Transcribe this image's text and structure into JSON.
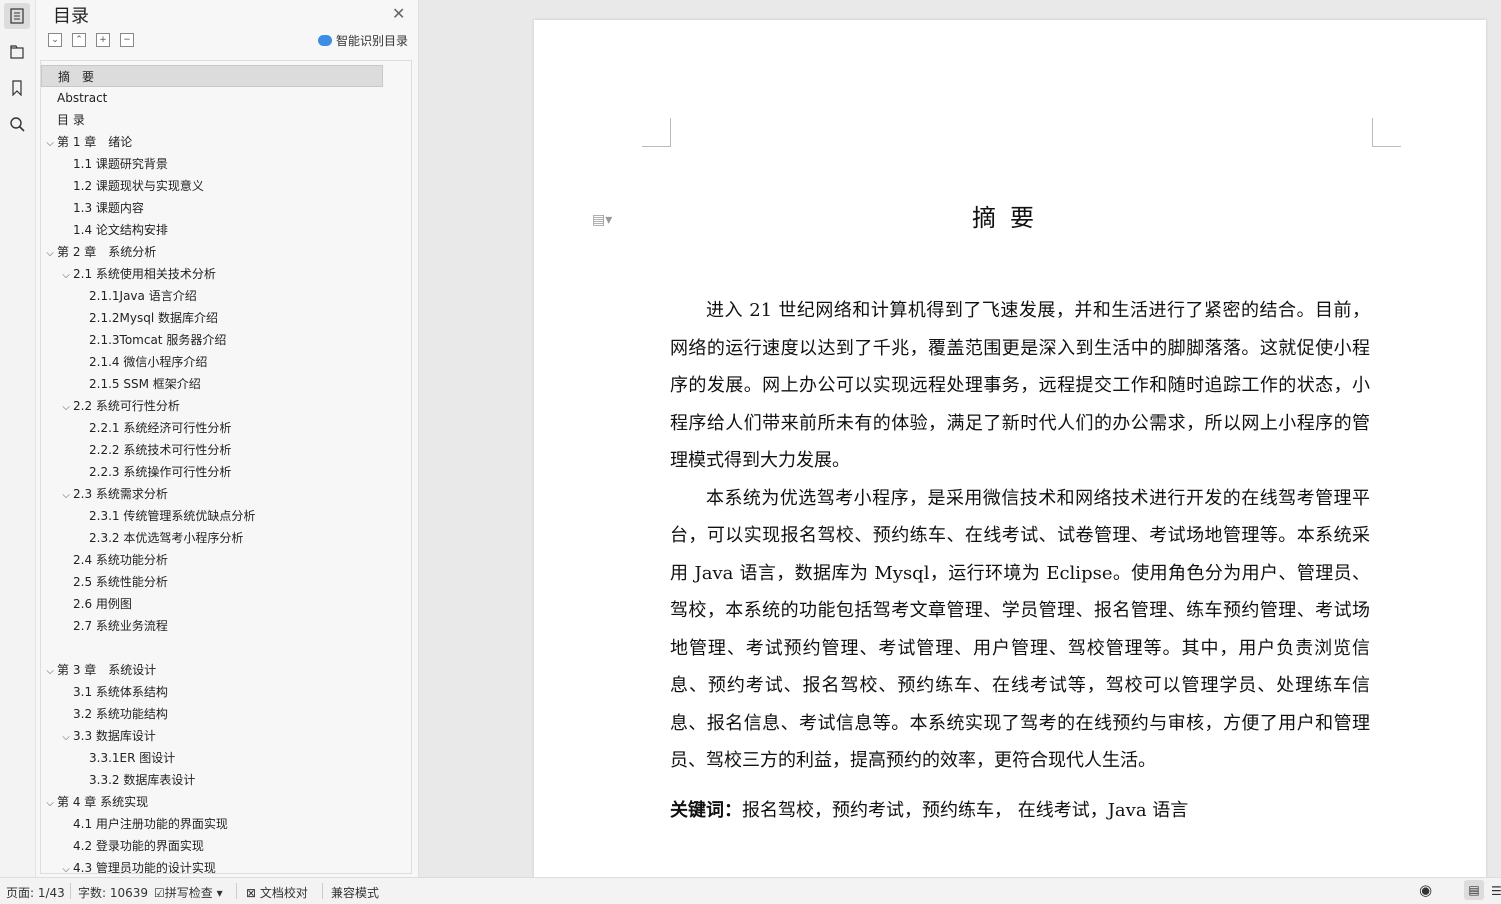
{
  "sidebar": {
    "title": "目录",
    "smart_toc": "智能识别目录",
    "tool_icons": [
      "collapse-icon",
      "expand-icon",
      "plus-icon",
      "minus-icon"
    ],
    "items": [
      {
        "label": "摘　要",
        "level": 0,
        "chevron": false,
        "selected": true
      },
      {
        "label": "Abstract",
        "level": 0,
        "chevron": false
      },
      {
        "label": "目  录",
        "level": 0,
        "chevron": false
      },
      {
        "label": "第 1 章　绪论",
        "level": 0,
        "chevron": true
      },
      {
        "label": "1.1 课题研究背景",
        "level": 1,
        "chevron": false
      },
      {
        "label": "1.2 课题现状与实现意义",
        "level": 1,
        "chevron": false
      },
      {
        "label": "1.3 课题内容",
        "level": 1,
        "chevron": false
      },
      {
        "label": "1.4 论文结构安排",
        "level": 1,
        "chevron": false
      },
      {
        "label": "第 2 章　系统分析",
        "level": 0,
        "chevron": true
      },
      {
        "label": "2.1 系统使用相关技术分析",
        "level": 1,
        "chevron": true
      },
      {
        "label": "2.1.1Java 语言介绍",
        "level": 2,
        "chevron": false
      },
      {
        "label": "2.1.2Mysql 数据库介绍",
        "level": 2,
        "chevron": false
      },
      {
        "label": "2.1.3Tomcat 服务器介绍",
        "level": 2,
        "chevron": false
      },
      {
        "label": "2.1.4 微信小程序介绍",
        "level": 2,
        "chevron": false
      },
      {
        "label": "2.1.5 SSM 框架介绍",
        "level": 2,
        "chevron": false
      },
      {
        "label": "2.2 系统可行性分析",
        "level": 1,
        "chevron": true
      },
      {
        "label": "2.2.1 系统经济可行性分析",
        "level": 2,
        "chevron": false
      },
      {
        "label": "2.2.2 系统技术可行性分析",
        "level": 2,
        "chevron": false
      },
      {
        "label": "2.2.3 系统操作可行性分析",
        "level": 2,
        "chevron": false
      },
      {
        "label": "2.3 系统需求分析",
        "level": 1,
        "chevron": true
      },
      {
        "label": "2.3.1 传统管理系统优缺点分析",
        "level": 2,
        "chevron": false
      },
      {
        "label": "2.3.2 本优选驾考小程序分析",
        "level": 2,
        "chevron": false
      },
      {
        "label": "2.4 系统功能分析",
        "level": 1,
        "chevron": false
      },
      {
        "label": "2.5 系统性能分析",
        "level": 1,
        "chevron": false
      },
      {
        "label": "2.6 用例图",
        "level": 1,
        "chevron": false
      },
      {
        "label": "2.7 系统业务流程",
        "level": 1,
        "chevron": false
      },
      {
        "label": "",
        "level": 0,
        "chevron": false
      },
      {
        "label": "第 3 章　系统设计",
        "level": 0,
        "chevron": true
      },
      {
        "label": "3.1 系统体系结构",
        "level": 1,
        "chevron": false
      },
      {
        "label": "3.2 系统功能结构",
        "level": 1,
        "chevron": false
      },
      {
        "label": "3.3 数据库设计",
        "level": 1,
        "chevron": true
      },
      {
        "label": "3.3.1ER 图设计",
        "level": 2,
        "chevron": false
      },
      {
        "label": "3.3.2 数据库表设计",
        "level": 2,
        "chevron": false
      },
      {
        "label": "第 4 章  系统实现",
        "level": 0,
        "chevron": true
      },
      {
        "label": "4.1 用户注册功能的界面实现",
        "level": 1,
        "chevron": false
      },
      {
        "label": "4.2 登录功能的界面实现",
        "level": 1,
        "chevron": false
      },
      {
        "label": "4.3 管理员功能的设计实现",
        "level": 1,
        "chevron": true
      }
    ]
  },
  "document": {
    "title": "摘要",
    "paragraphs": [
      "进入 21 世纪网络和计算机得到了飞速发展，并和生活进行了紧密的结合。目前，网络的运行速度以达到了千兆，覆盖范围更是深入到生活中的脚脚落落。这就促使小程序的发展。网上办公可以实现远程处理事务，远程提交工作和随时追踪工作的状态，小程序给人们带来前所未有的体验，满足了新时代人们的办公需求，所以网上小程序的管理模式得到大力发展。",
      "本系统为优选驾考小程序，是采用微信技术和网络技术进行开发的在线驾考管理平台，可以实现报名驾校、预约练车、在线考试、试卷管理、考试场地管理等。本系统采用 Java 语言，数据库为 Mysql，运行环境为 Eclipse。使用角色分为用户、管理员、驾校，本系统的功能包括驾考文章管理、学员管理、报名管理、练车预约管理、考试场地管理、考试预约管理、考试管理、用户管理、驾校管理等。其中，用户负责浏览信息、预约考试、报名驾校、预约练车、在线考试等，驾校可以管理学员、处理练车信息、报名信息、考试信息等。本系统实现了驾考的在线预约与审核，方便了用户和管理员、驾校三方的利益，提高预约的效率，更符合现代人生活。"
    ],
    "keywords_label": "关键词：",
    "keywords": "报名驾校，预约考试，预约练车，  在线考试，Java 语言"
  },
  "status_bar": {
    "page": "页面: 1/43",
    "word_count": "字数: 10639",
    "spell_check": "拼写检查",
    "doc_check": "文档校对",
    "compat_mode": "兼容模式"
  }
}
